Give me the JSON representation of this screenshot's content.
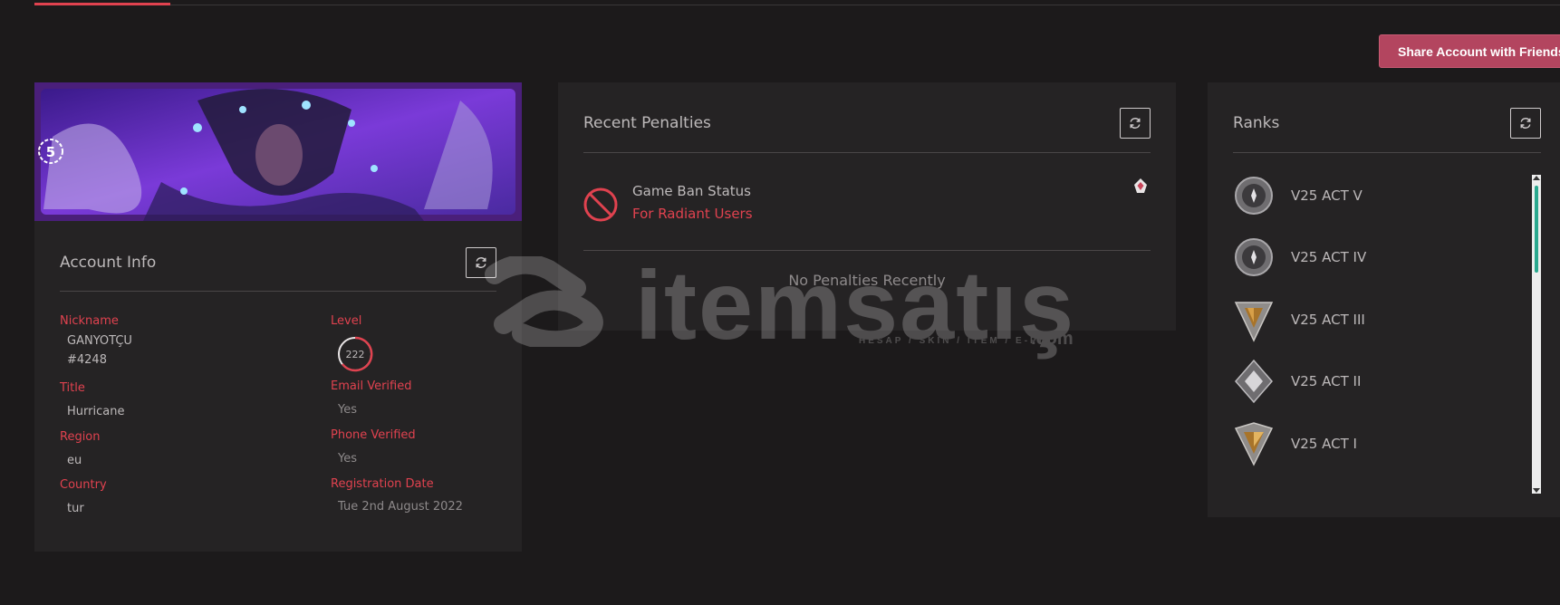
{
  "header": {
    "share_label": "Share Account with Friends"
  },
  "account": {
    "title": "Account Info",
    "fields": {
      "nickname_label": "Nickname",
      "nickname_name": "GANYOTÇU",
      "nickname_tag": "#4248",
      "title_label": "Title",
      "title_value": "Hurricane",
      "region_label": "Region",
      "region_value": "eu",
      "country_label": "Country",
      "country_value": "tur",
      "level_label": "Level",
      "level_value": "222",
      "email_label": "Email Verified",
      "email_value": "Yes",
      "phone_label": "Phone Verified",
      "phone_value": "Yes",
      "registration_label": "Registration Date",
      "registration_value": "Tue 2nd August 2022"
    },
    "banner_badge": "5"
  },
  "penalties": {
    "title": "Recent Penalties",
    "ban_status_label": "Game Ban Status",
    "ban_status_value": "For Radiant Users",
    "empty_text": "No Penalties Recently"
  },
  "ranks": {
    "title": "Ranks",
    "items": [
      {
        "name": "V25 ACT V",
        "emblem": "iron-rank-icon"
      },
      {
        "name": "V25 ACT IV",
        "emblem": "iron-rank-icon"
      },
      {
        "name": "V25 ACT III",
        "emblem": "bronze-rank-icon"
      },
      {
        "name": "V25 ACT II",
        "emblem": "unranked-silver-icon"
      },
      {
        "name": "V25 ACT I",
        "emblem": "bronze-rank-icon"
      }
    ]
  },
  "watermark": {
    "brand": "itemsatış",
    "tagline": "HESAP / SKIN / ITEM / E-PIN",
    "suffix": ".com"
  },
  "colors": {
    "accent": "#e0424f",
    "share_button": "#b3455f",
    "banner": "#5b2aa8",
    "scroll_thumb": "#2aa88e"
  }
}
